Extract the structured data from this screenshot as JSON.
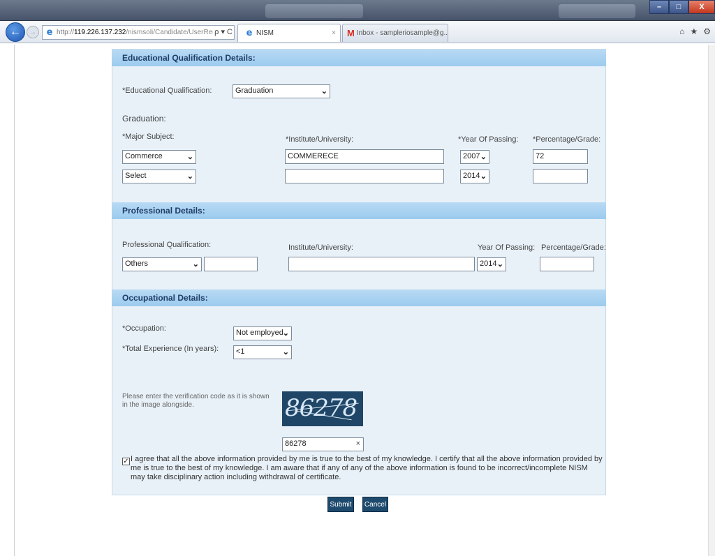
{
  "browser": {
    "back_icon": "back-arrow-icon",
    "url_scheme": "http://",
    "url_host": "119.226.137.232",
    "url_path": "/nismsoli/Candidate/UserRegstr",
    "addr_tools": "ρ ▾ C",
    "tabs": [
      {
        "label": "NISM",
        "close": "×"
      },
      {
        "label": "Inbox - sampleriosample@g...",
        "close": ""
      }
    ],
    "gmail_icon": "M",
    "window_buttons": [
      "–",
      "□",
      "X"
    ],
    "right_icons": [
      "⌂",
      "★",
      "⚙"
    ]
  },
  "education": {
    "header": "Educational Qualification Details:",
    "qualification_label": "*Educational Qualification:",
    "qualification_value": "Graduation",
    "subheading": "Graduation:",
    "col_subject": "*Major Subject:",
    "col_institute": "*Institute/University:",
    "col_year": "*Year Of Passing:",
    "col_percentage": "*Percentage/Grade:",
    "rows": [
      {
        "subject": "Commerce",
        "institute": "COMMERECE",
        "year": "2007",
        "percentage": "72"
      },
      {
        "subject": "Select",
        "institute": "",
        "year": "2014",
        "percentage": ""
      }
    ]
  },
  "professional": {
    "header": "Professional Details:",
    "col_qualification": "Professional Qualification:",
    "col_institute": "Institute/University:",
    "col_year": "Year Of Passing:",
    "col_percentage": "Percentage/Grade:",
    "qualification": "Others",
    "other_text": "",
    "institute": "",
    "year": "2014",
    "percentage": ""
  },
  "occupational": {
    "header": "Occupational Details:",
    "occupation_label": "*Occupation:",
    "occupation_value": "Not employed",
    "experience_label": "*Total Experience (In years):",
    "experience_value": "<1"
  },
  "verification": {
    "instruction": "Please enter the verification code as it is shown in the image alongside.",
    "captcha_text": "86278",
    "input_value": "86278",
    "clear_icon": "×"
  },
  "agreement": {
    "checked": "✓",
    "text": "I agree that all the above information provided by me is true to the best of my knowledge. I certify that all the above information provided by me is true to the best of my knowledge. I am aware that if any of any of the above information is found to be incorrect/incomplete NISM may take disciplinary action including withdrawal of certificate."
  },
  "actions": {
    "submit": "Submit",
    "cancel": "Cancel"
  },
  "dropdown_arrow": "⌄"
}
